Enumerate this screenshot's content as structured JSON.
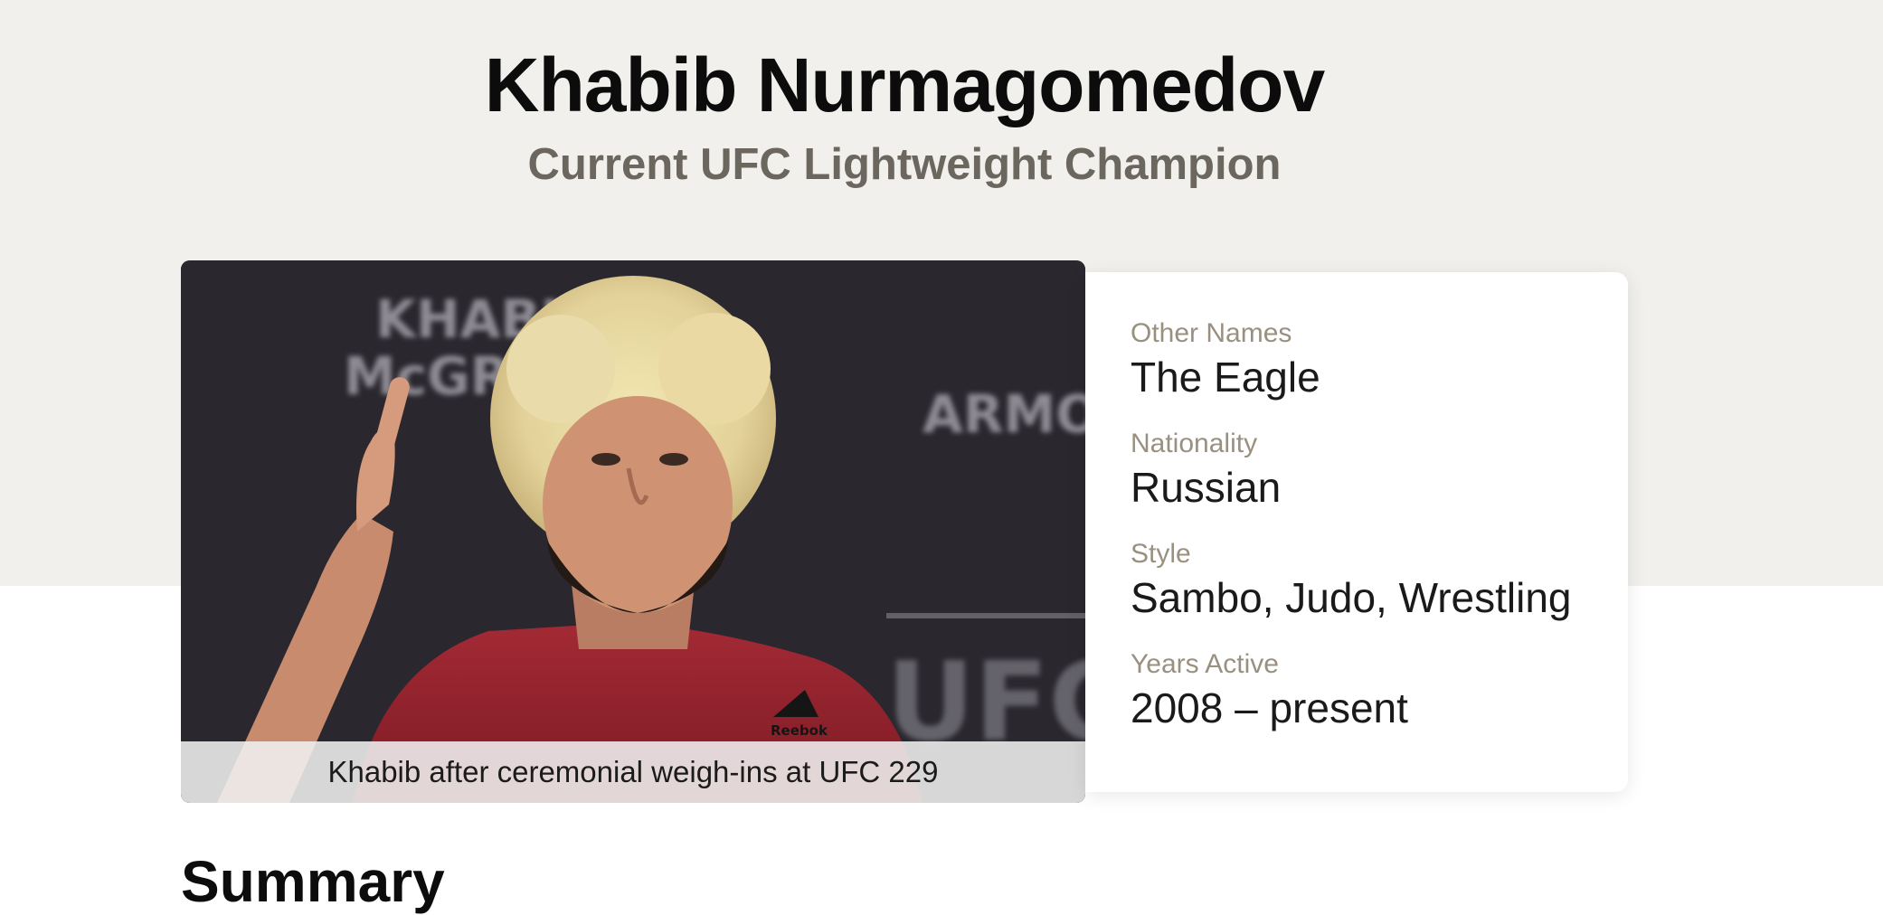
{
  "header": {
    "title": "Khabib Nurmagomedov",
    "subtitle": "Current UFC Lightweight Champion"
  },
  "photo": {
    "caption": "Khabib after ceremonial weigh-ins at UFC 229",
    "backdrop_text": [
      "KHABIB v",
      "McGREGOR",
      "ARMOR",
      "UFC"
    ],
    "shirt_logo": "Reebok"
  },
  "info": [
    {
      "label": "Other Names",
      "value": "The Eagle"
    },
    {
      "label": "Nationality",
      "value": "Russian"
    },
    {
      "label": "Style",
      "value": "Sambo, Judo, Wrestling"
    },
    {
      "label": "Years Active",
      "value": "2008 – present"
    }
  ],
  "sections": {
    "summary_heading": "Summary"
  },
  "colors": {
    "hero_background": "#f1f0ec",
    "label": "#9a9080",
    "subtitle": "#6b665e"
  }
}
